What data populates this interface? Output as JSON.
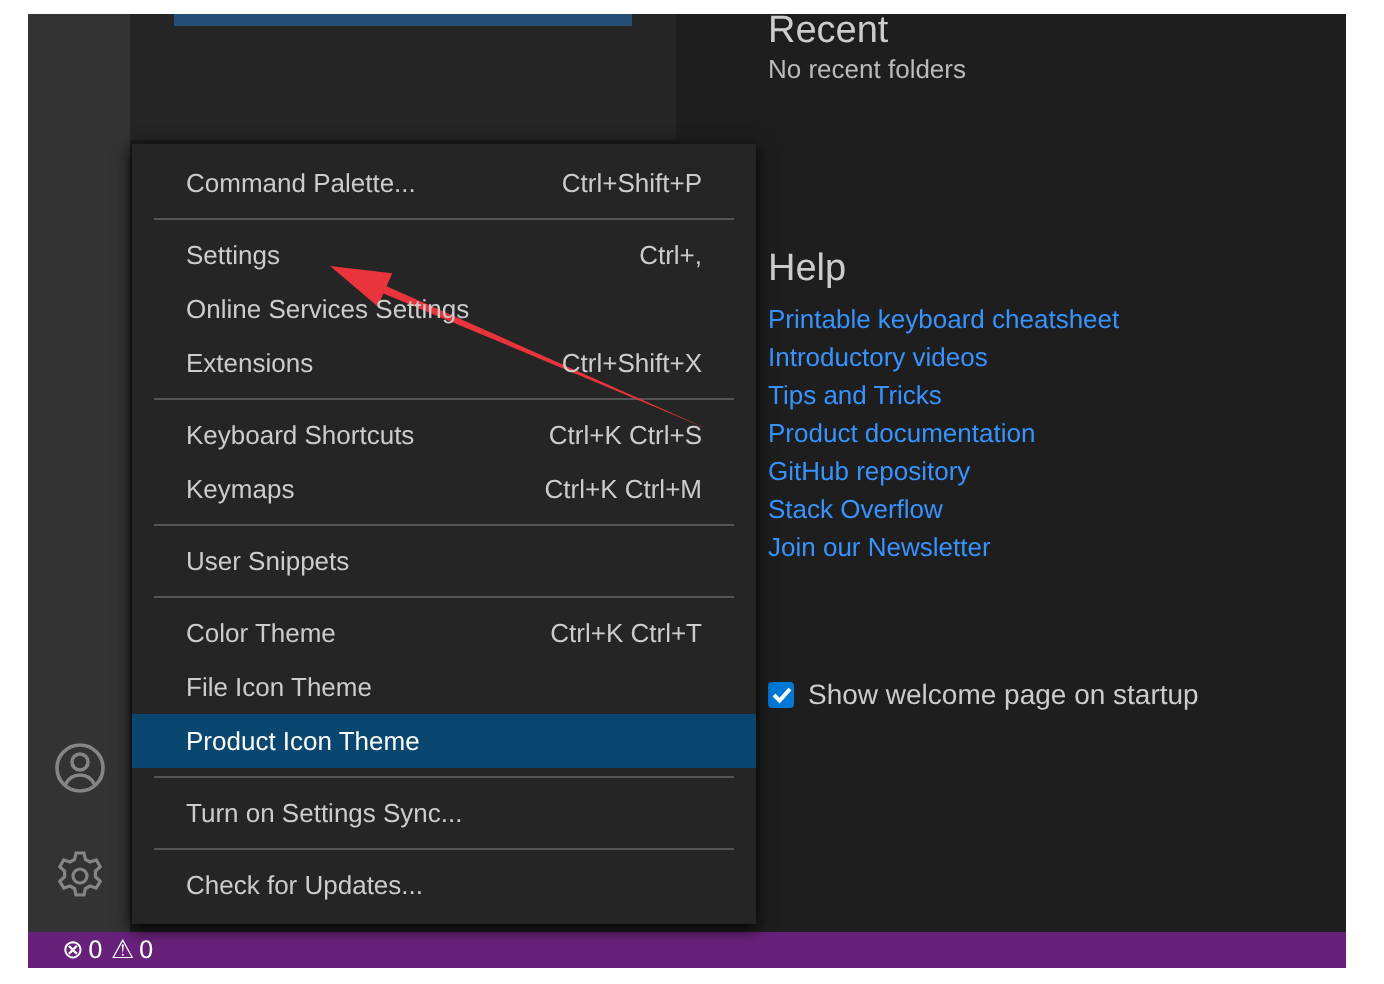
{
  "welcome": {
    "recent": {
      "heading": "Recent",
      "empty_text": "No recent folders"
    },
    "help": {
      "heading": "Help",
      "links": [
        "Printable keyboard cheatsheet",
        "Introductory videos",
        "Tips and Tricks",
        "Product documentation",
        "GitHub repository",
        "Stack Overflow",
        "Join our Newsletter"
      ]
    },
    "startup_checkbox": {
      "label": "Show welcome page on startup",
      "checked": true
    }
  },
  "menu": {
    "items": [
      {
        "kind": "item",
        "label": "Command Palette...",
        "shortcut": "Ctrl+Shift+P",
        "selected": false
      },
      {
        "kind": "separator"
      },
      {
        "kind": "item",
        "label": "Settings",
        "shortcut": "Ctrl+,",
        "selected": false
      },
      {
        "kind": "item",
        "label": "Online Services Settings",
        "selected": false
      },
      {
        "kind": "item",
        "label": "Extensions",
        "shortcut": "Ctrl+Shift+X",
        "selected": false
      },
      {
        "kind": "separator"
      },
      {
        "kind": "item",
        "label": "Keyboard Shortcuts",
        "shortcut": "Ctrl+K Ctrl+S",
        "selected": false
      },
      {
        "kind": "item",
        "label": "Keymaps",
        "shortcut": "Ctrl+K Ctrl+M",
        "selected": false
      },
      {
        "kind": "separator"
      },
      {
        "kind": "item",
        "label": "User Snippets",
        "selected": false
      },
      {
        "kind": "separator"
      },
      {
        "kind": "item",
        "label": "Color Theme",
        "shortcut": "Ctrl+K Ctrl+T",
        "selected": false
      },
      {
        "kind": "item",
        "label": "File Icon Theme",
        "selected": false
      },
      {
        "kind": "item",
        "label": "Product Icon Theme",
        "selected": true
      },
      {
        "kind": "separator"
      },
      {
        "kind": "item",
        "label": "Turn on Settings Sync...",
        "selected": false
      },
      {
        "kind": "separator"
      },
      {
        "kind": "item",
        "label": "Check for Updates...",
        "selected": false
      }
    ]
  },
  "status_bar": {
    "error_icon": "⊗",
    "errors": "0",
    "warning_icon": "⚠",
    "warnings": "0"
  }
}
